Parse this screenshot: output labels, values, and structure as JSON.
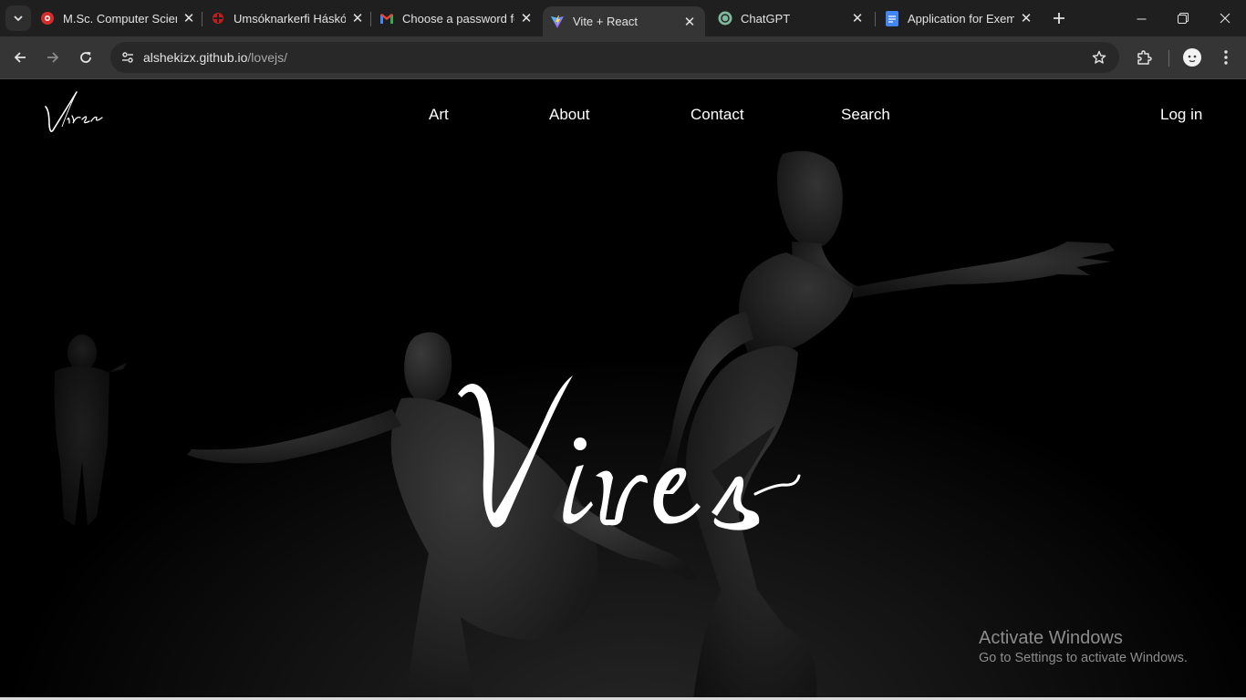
{
  "browser": {
    "tabs": [
      {
        "title": "M.Sc. Computer Scien",
        "favicon": "hi-logo-icon",
        "active": false
      },
      {
        "title": "Umsóknarkerfi Háskól",
        "favicon": "hi-logo-icon",
        "active": false
      },
      {
        "title": "Choose a password fo",
        "favicon": "gmail-icon",
        "active": false
      },
      {
        "title": "Vite + React",
        "favicon": "vite-icon",
        "active": true
      },
      {
        "title": "ChatGPT",
        "favicon": "chatgpt-icon",
        "active": false
      },
      {
        "title": "Application for Exemp",
        "favicon": "docs-icon",
        "active": false
      }
    ],
    "address": {
      "host": "alshekizx.github.io",
      "path": "/lovejs/"
    }
  },
  "site": {
    "logo_text": "Vires",
    "nav": {
      "art": "Art",
      "about": "About",
      "contact": "Contact",
      "search": "Search"
    },
    "login": "Log in",
    "hero_title": "Vires"
  },
  "os_watermark": {
    "title": "Activate Windows",
    "subtitle": "Go to Settings to activate Windows."
  },
  "colors": {
    "accent_text": "#ffffff",
    "chrome_bg": "#1f1f1f",
    "toolbar_bg": "#353535",
    "page_bg": "#000000"
  }
}
